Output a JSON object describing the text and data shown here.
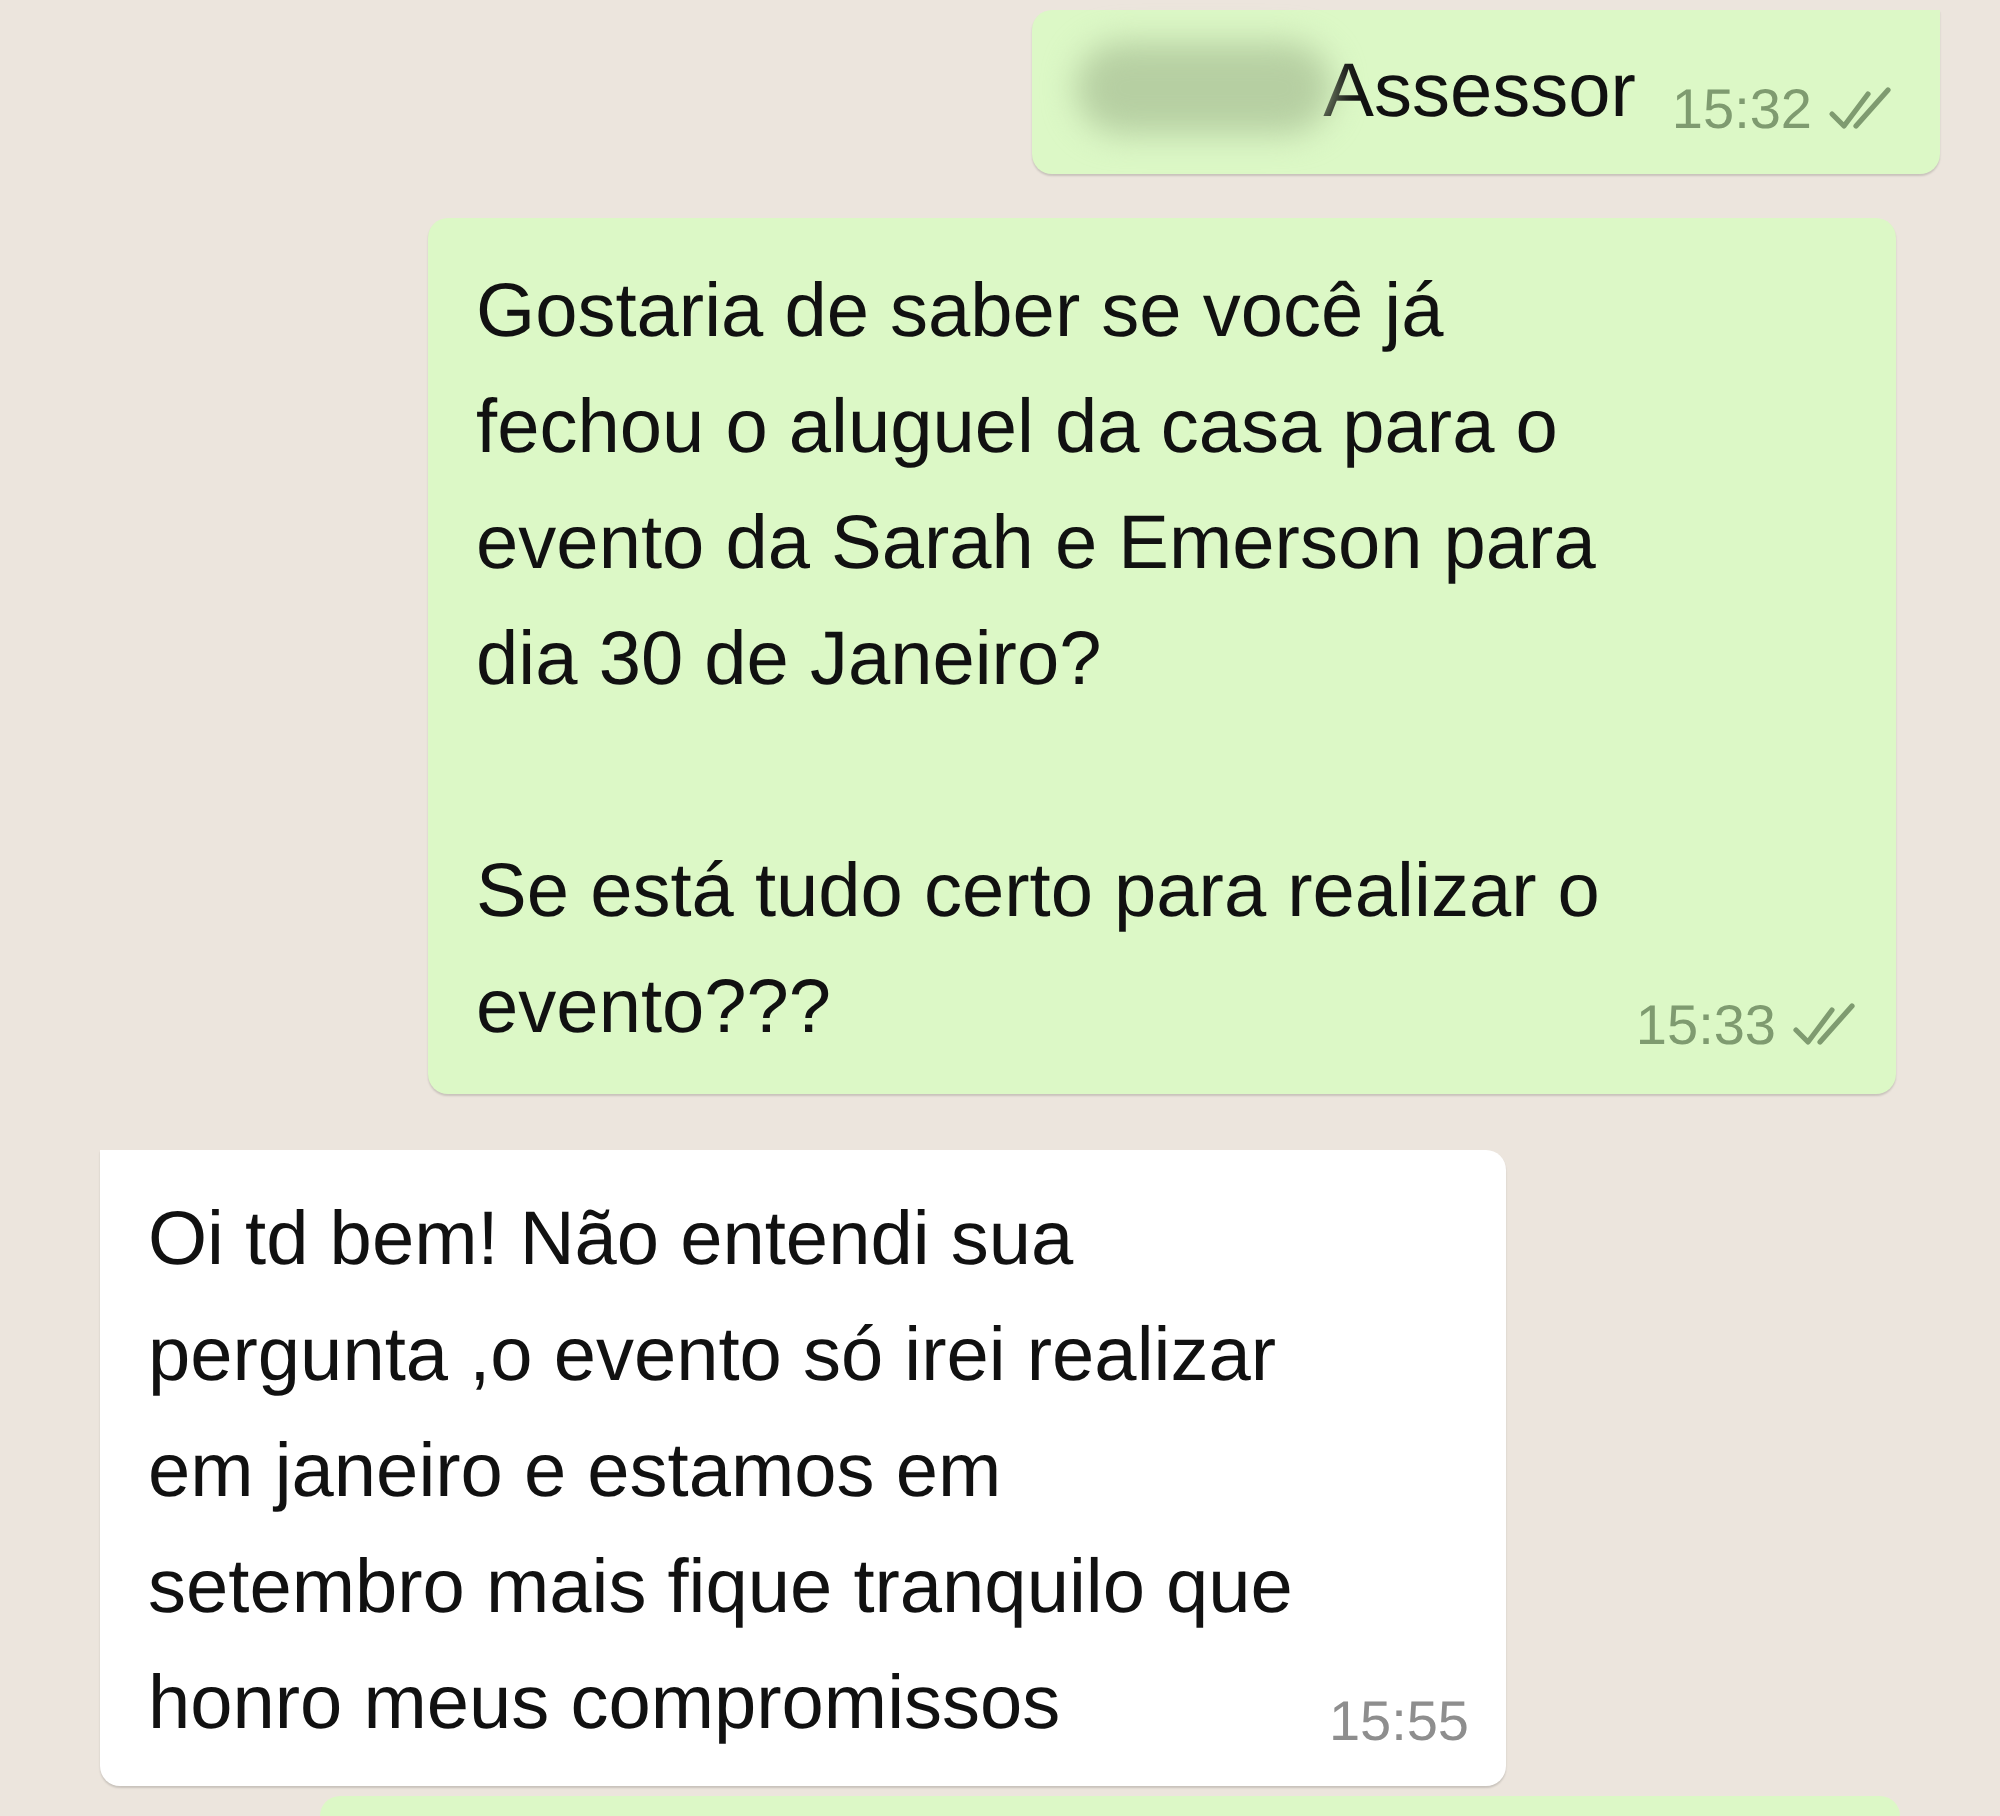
{
  "messages": [
    {
      "kind": "outgoing",
      "text": "Assessor",
      "time": "15:32",
      "delivered": true,
      "read": false,
      "redacted_prefix": true
    },
    {
      "kind": "outgoing",
      "text": "Gostaria de saber se você já\nfechou o aluguel da casa para o\nevento da Sarah e Emerson para\ndia 30 de Janeiro?\n\nSe está tudo certo para realizar o\nevento???",
      "time": "15:33",
      "delivered": true,
      "read": false
    },
    {
      "kind": "incoming",
      "text": "Oi td bem! Não entendi sua\npergunta ,o evento só irei realizar\nem janeiro e estamos em\nsetembro mais fique tranquilo que\nhonro meus compromissos",
      "time": "15:55"
    }
  ]
}
